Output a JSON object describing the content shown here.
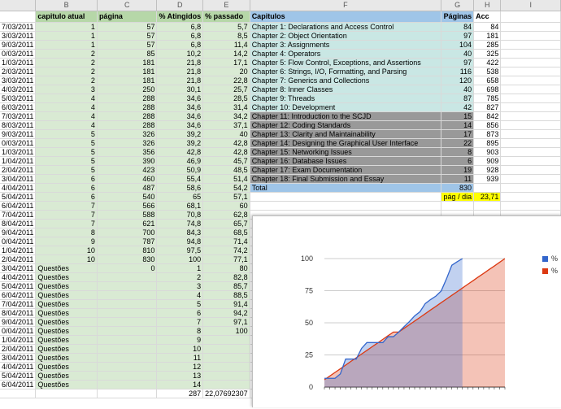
{
  "columns": [
    "",
    "B",
    "C",
    "D",
    "E",
    "F",
    "G",
    "H",
    "I"
  ],
  "headers": {
    "a": "",
    "b": "capitulo atual",
    "c": "página",
    "d": "% Atingidos",
    "e": "% passado",
    "f": "Capitulos",
    "g": "Páginas",
    "h": "Acc",
    "i": ""
  },
  "rows": [
    {
      "a": "7/03/2011",
      "b": "1",
      "c": "57",
      "d": "6,8",
      "e": "5,7",
      "f": "Chapter 1: Declarations and Access Control",
      "g": "84",
      "h": "84",
      "ft": "b"
    },
    {
      "a": "3/03/2011",
      "b": "1",
      "c": "57",
      "d": "6,8",
      "e": "8,5",
      "f": "Chapter 2: Object Orientation",
      "g": "97",
      "h": "181",
      "ft": "b"
    },
    {
      "a": "9/03/2011",
      "b": "1",
      "c": "57",
      "d": "6,8",
      "e": "11,4",
      "f": "Chapter 3: Assignments",
      "g": "104",
      "h": "285",
      "ft": "b"
    },
    {
      "a": "0/03/2011",
      "b": "2",
      "c": "85",
      "d": "10,2",
      "e": "14,2",
      "f": "Chapter 4: Operators",
      "g": "40",
      "h": "325",
      "ft": "b"
    },
    {
      "a": "1/03/2011",
      "b": "2",
      "c": "181",
      "d": "21,8",
      "e": "17,1",
      "f": "Chapter 5: Flow Control, Exceptions, and Assertions",
      "g": "97",
      "h": "422",
      "ft": "b"
    },
    {
      "a": "2/03/2011",
      "b": "2",
      "c": "181",
      "d": "21,8",
      "e": "20",
      "f": "Chapter 6: Strings, I/O, Formatting, and Parsing",
      "g": "116",
      "h": "538",
      "ft": "b"
    },
    {
      "a": "3/03/2011",
      "b": "2",
      "c": "181",
      "d": "21,8",
      "e": "22,8",
      "f": "Chapter 7: Generics and Collections",
      "g": "120",
      "h": "658",
      "ft": "b"
    },
    {
      "a": "4/03/2011",
      "b": "3",
      "c": "250",
      "d": "30,1",
      "e": "25,7",
      "f": "Chapter 8: Inner Classes",
      "g": "40",
      "h": "698",
      "ft": "b"
    },
    {
      "a": "5/03/2011",
      "b": "4",
      "c": "288",
      "d": "34,6",
      "e": "28,5",
      "f": "Chapter 9: Threads",
      "g": "87",
      "h": "785",
      "ft": "b"
    },
    {
      "a": "6/03/2011",
      "b": "4",
      "c": "288",
      "d": "34,6",
      "e": "31,4",
      "f": "Chapter 10: Development",
      "g": "42",
      "h": "827",
      "ft": "b"
    },
    {
      "a": "7/03/2011",
      "b": "4",
      "c": "288",
      "d": "34,6",
      "e": "34,2",
      "f": "Chapter 11: Introduction to the SCJD",
      "g": "15",
      "h": "842",
      "ft": "gr"
    },
    {
      "a": "8/03/2011",
      "b": "4",
      "c": "288",
      "d": "34,6",
      "e": "37,1",
      "f": "Chapter 12: Coding Standards",
      "g": "14",
      "h": "856",
      "ft": "gr"
    },
    {
      "a": "9/03/2011",
      "b": "5",
      "c": "326",
      "d": "39,2",
      "e": "40",
      "f": "Chapter 13: Clarity and Maintainability",
      "g": "17",
      "h": "873",
      "ft": "gr"
    },
    {
      "a": "0/03/2011",
      "b": "5",
      "c": "326",
      "d": "39,2",
      "e": "42,8",
      "f": "Chapter 14: Designing the Graphical User Interface",
      "g": "22",
      "h": "895",
      "ft": "gr"
    },
    {
      "a": "1/03/2011",
      "b": "5",
      "c": "356",
      "d": "42,8",
      "e": "42,8",
      "f": "Chapter 15: Networking Issues",
      "g": "8",
      "h": "903",
      "ft": "gr"
    },
    {
      "a": "1/04/2011",
      "b": "5",
      "c": "390",
      "d": "46,9",
      "e": "45,7",
      "f": "Chapter 16: Database Issues",
      "g": "6",
      "h": "909",
      "ft": "gr"
    },
    {
      "a": "2/04/2011",
      "b": "5",
      "c": "423",
      "d": "50,9",
      "e": "48,5",
      "f": "Chapter 17: Exam Documentation",
      "g": "19",
      "h": "928",
      "ft": "gr"
    },
    {
      "a": "3/04/2011",
      "b": "6",
      "c": "460",
      "d": "55,4",
      "e": "51,4",
      "f": "Chapter 18: Final Submission and Essay",
      "g": "11",
      "h": "939",
      "ft": "gr"
    },
    {
      "a": "4/04/2011",
      "b": "6",
      "c": "487",
      "d": "58,6",
      "e": "54,2",
      "f": "Total",
      "g": "830",
      "h": "",
      "ft": "tot"
    },
    {
      "a": "5/04/2011",
      "b": "6",
      "c": "540",
      "d": "65",
      "e": "57,1",
      "f": "",
      "g": "pág / dia",
      "h": "23,71",
      "ft": "y"
    },
    {
      "a": "6/04/2011",
      "b": "7",
      "c": "566",
      "d": "68,1",
      "e": "60",
      "f": "",
      "g": "",
      "h": "",
      "ft": ""
    },
    {
      "a": "7/04/2011",
      "b": "7",
      "c": "588",
      "d": "70,8",
      "e": "62,8",
      "f": "",
      "g": "",
      "h": "",
      "ft": ""
    },
    {
      "a": "8/04/2011",
      "b": "7",
      "c": "621",
      "d": "74,8",
      "e": "65,7",
      "f": "",
      "g": "",
      "h": "",
      "ft": ""
    },
    {
      "a": "9/04/2011",
      "b": "8",
      "c": "700",
      "d": "84,3",
      "e": "68,5",
      "f": "",
      "g": "",
      "h": "",
      "ft": ""
    },
    {
      "a": "0/04/2011",
      "b": "9",
      "c": "787",
      "d": "94,8",
      "e": "71,4",
      "f": "",
      "g": "",
      "h": "",
      "ft": ""
    },
    {
      "a": "1/04/2011",
      "b": "10",
      "c": "810",
      "d": "97,5",
      "e": "74,2",
      "f": "",
      "g": "",
      "h": "",
      "ft": ""
    },
    {
      "a": "2/04/2011",
      "b": "10",
      "c": "830",
      "d": "100",
      "e": "77,1",
      "f": "",
      "g": "",
      "h": "",
      "ft": ""
    },
    {
      "a": "3/04/2011",
      "b": "Questões",
      "c": "0",
      "d": "1",
      "e": "80",
      "f": "",
      "g": "",
      "h": "",
      "ft": ""
    },
    {
      "a": "4/04/2011",
      "b": "Questões",
      "c": "",
      "d": "2",
      "e": "82,8",
      "f": "",
      "g": "",
      "h": "",
      "ft": ""
    },
    {
      "a": "5/04/2011",
      "b": "Questões",
      "c": "",
      "d": "3",
      "e": "85,7",
      "f": "",
      "g": "",
      "h": "",
      "ft": ""
    },
    {
      "a": "6/04/2011",
      "b": "Questões",
      "c": "",
      "d": "4",
      "e": "88,5",
      "f": "",
      "g": "",
      "h": "",
      "ft": ""
    },
    {
      "a": "7/04/2011",
      "b": "Questões",
      "c": "",
      "d": "5",
      "e": "91,4",
      "f": "",
      "g": "",
      "h": "",
      "ft": ""
    },
    {
      "a": "8/04/2011",
      "b": "Questões",
      "c": "",
      "d": "6",
      "e": "94,2",
      "f": "",
      "g": "",
      "h": "",
      "ft": ""
    },
    {
      "a": "9/04/2011",
      "b": "Questões",
      "c": "",
      "d": "7",
      "e": "97,1",
      "f": "",
      "g": "",
      "h": "",
      "ft": ""
    },
    {
      "a": "0/04/2011",
      "b": "Questões",
      "c": "",
      "d": "8",
      "e": "100",
      "f": "",
      "g": "",
      "h": "",
      "ft": ""
    },
    {
      "a": "1/04/2011",
      "b": "Questões",
      "c": "",
      "d": "9",
      "e": "",
      "f": "",
      "g": "",
      "h": "",
      "ft": ""
    },
    {
      "a": "2/04/2011",
      "b": "Questões",
      "c": "",
      "d": "10",
      "e": "",
      "f": "",
      "g": "",
      "h": "",
      "ft": ""
    },
    {
      "a": "3/04/2011",
      "b": "Questões",
      "c": "",
      "d": "11",
      "e": "",
      "f": "",
      "g": "",
      "h": "",
      "ft": ""
    },
    {
      "a": "4/04/2011",
      "b": "Questões",
      "c": "",
      "d": "12",
      "e": "",
      "f": "",
      "g": "",
      "h": "",
      "ft": ""
    },
    {
      "a": "5/04/2011",
      "b": "Questões",
      "c": "",
      "d": "13",
      "e": "",
      "f": "",
      "g": "",
      "h": "",
      "ft": ""
    },
    {
      "a": "6/04/2011",
      "b": "Questões",
      "c": "",
      "d": "14",
      "e": "",
      "f": "",
      "g": "",
      "h": "",
      "ft": ""
    },
    {
      "a": "",
      "b": "",
      "c": "",
      "d": "287",
      "e": "22,07692307",
      "f": "",
      "g": "",
      "h": "",
      "ft": "",
      "plain": true
    }
  ],
  "colors": {
    "green": "#d9ead3",
    "green_header": "#b6d7a8",
    "blue": "#c9e7e4",
    "blue_header": "#9fc5e8",
    "gray": "#999999",
    "yellow": "#ffff00",
    "series_blue": "#3366cc",
    "series_red": "#dc3912"
  },
  "chart_data": {
    "type": "area",
    "ylim": [
      0,
      100
    ],
    "yticks": [
      0,
      25,
      50,
      75,
      100
    ],
    "legend_position": "right",
    "series": [
      {
        "name": "%",
        "color": "#3366cc",
        "values": [
          6.8,
          6.8,
          6.8,
          10.2,
          21.8,
          21.8,
          21.8,
          30.1,
          34.6,
          34.6,
          34.6,
          34.6,
          39.2,
          39.2,
          42.8,
          46.9,
          50.9,
          55.4,
          58.6,
          65,
          68.1,
          70.8,
          74.8,
          84.3,
          94.8,
          97.5,
          100
        ]
      },
      {
        "name": "%",
        "color": "#dc3912",
        "values": [
          5.7,
          8.5,
          11.4,
          14.2,
          17.1,
          20,
          22.8,
          25.7,
          28.5,
          31.4,
          34.2,
          37.1,
          40,
          42.8,
          42.8,
          45.7,
          48.5,
          51.4,
          54.2,
          57.1,
          60,
          62.8,
          65.7,
          68.5,
          71.4,
          74.2,
          77.1,
          80,
          82.8,
          85.7,
          88.5,
          91.4,
          94.2,
          97.1,
          100
        ]
      }
    ]
  }
}
